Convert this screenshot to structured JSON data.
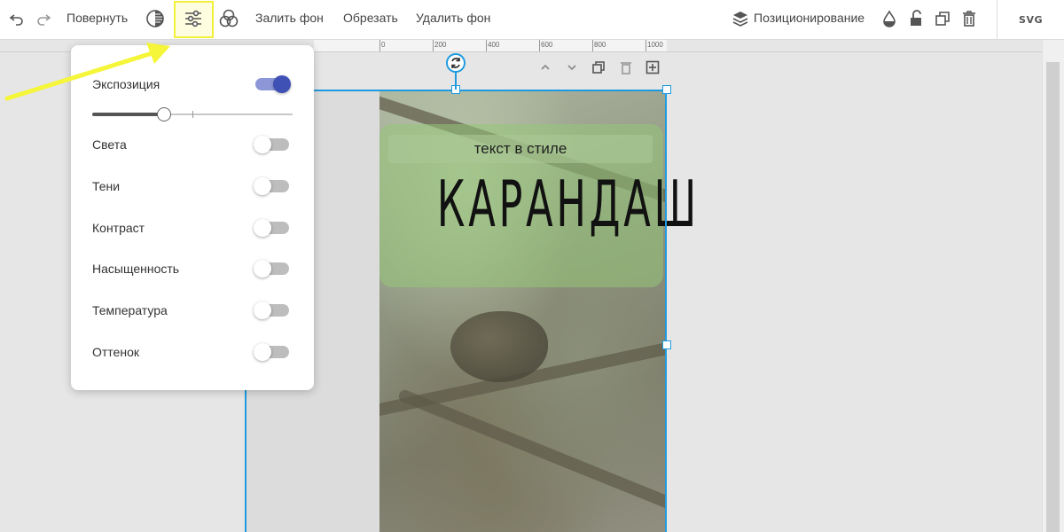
{
  "toolbar": {
    "rotate_label": "Повернуть",
    "fill_bg_label": "Залить фон",
    "crop_label": "Обрезать",
    "remove_bg_label": "Удалить фон",
    "positioning_label": "Позиционирование",
    "svg_label": "SVG"
  },
  "ruler": {
    "labels": [
      "0",
      "200",
      "400",
      "600",
      "800",
      "1000"
    ]
  },
  "canvas": {
    "subtitle": "текст в стиле",
    "title": "КАРАНДАШ"
  },
  "adjust_panel": {
    "exposure": {
      "label": "Экспозиция",
      "enabled": true,
      "value": 0.36
    },
    "items": [
      {
        "label": "Света",
        "enabled": false
      },
      {
        "label": "Тени",
        "enabled": false
      },
      {
        "label": "Контраст",
        "enabled": false
      },
      {
        "label": "Насыщенность",
        "enabled": false
      },
      {
        "label": "Температура",
        "enabled": false
      },
      {
        "label": "Оттенок",
        "enabled": false
      }
    ]
  },
  "colors": {
    "accent": "#3f51b5",
    "selection": "#1f9ae0",
    "highlight": "#f3f03a"
  }
}
